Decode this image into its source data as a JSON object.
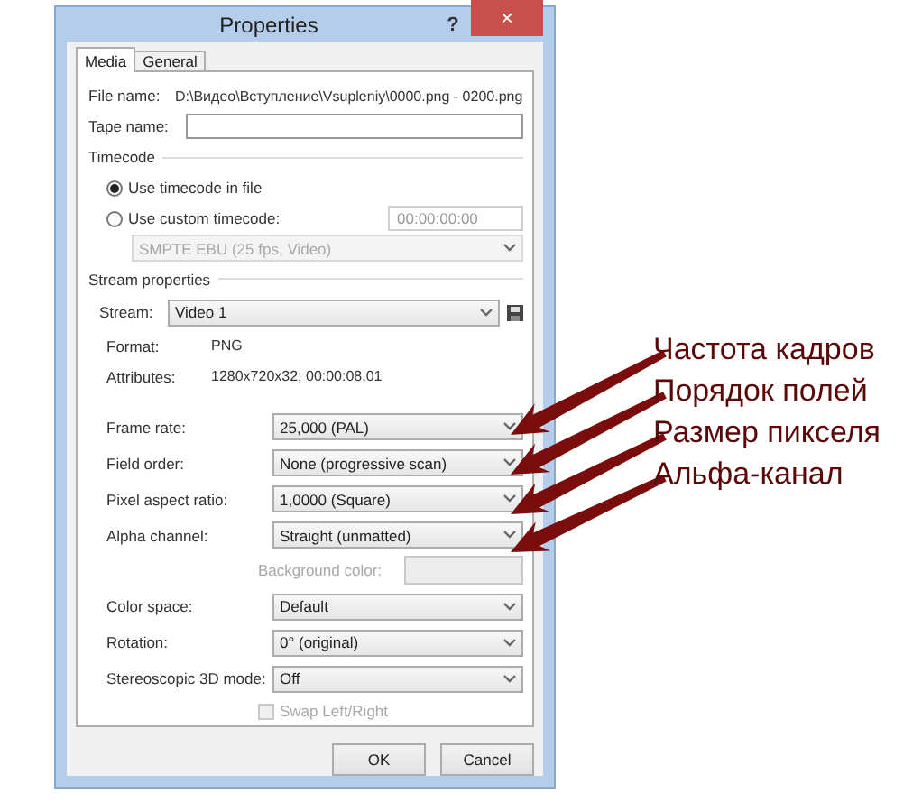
{
  "window": {
    "title": "Properties",
    "help": "?",
    "close": "×"
  },
  "tabs": [
    {
      "label": "Media",
      "selected": true
    },
    {
      "label": "General",
      "selected": false
    }
  ],
  "file_name": {
    "label": "File name:",
    "value": "D:\\Видео\\Вступление\\Vsupleniy\\0000.png - 0200.png"
  },
  "tape_name": {
    "label": "Tape name:"
  },
  "timecode": {
    "title": "Timecode",
    "options": [
      {
        "label": "Use timecode in file",
        "selected": true
      },
      {
        "label": "Use custom timecode:",
        "selected": false
      }
    ],
    "custom_value": "00:00:00:00",
    "preset": "SMPTE EBU (25 fps, Video)"
  },
  "stream_properties": {
    "title": "Stream properties",
    "stream": {
      "label": "Stream:",
      "value": "Video 1"
    },
    "info": [
      {
        "label": "Format:",
        "value": "PNG"
      },
      {
        "label": "Attributes:",
        "value": "1280x720x32; 00:00:08,01"
      }
    ]
  },
  "settings": [
    {
      "kind": "dropdown",
      "label": "Frame rate:",
      "value": "25,000 (PAL)",
      "disabled": false
    },
    {
      "kind": "dropdown",
      "label": "Field order:",
      "value": "None (progressive scan)",
      "disabled": false
    },
    {
      "kind": "dropdown",
      "label": "Pixel aspect ratio:",
      "value": "1,0000 (Square)",
      "disabled": false
    },
    {
      "kind": "dropdown",
      "label": "Alpha channel:",
      "value": "Straight (unmatted)",
      "disabled": false
    },
    {
      "kind": "color",
      "label": "Background color:",
      "disabled": true
    },
    {
      "kind": "dropdown",
      "label": "Color space:",
      "value": "Default",
      "disabled": false
    },
    {
      "kind": "dropdown",
      "label": "Rotation:",
      "value": "0° (original)",
      "disabled": false
    },
    {
      "kind": "dropdown",
      "label": "Stereoscopic 3D mode:",
      "value": "Off",
      "disabled": false
    },
    {
      "kind": "checkbox",
      "label": "Swap Left/Right",
      "checked": false,
      "disabled": true
    }
  ],
  "buttons": [
    "OK",
    "Cancel"
  ],
  "annotations": [
    {
      "text": "Частота кадров"
    },
    {
      "text": "Порядок полей"
    },
    {
      "text": "Размер пикселя"
    },
    {
      "text": "Альфа-канал"
    }
  ]
}
